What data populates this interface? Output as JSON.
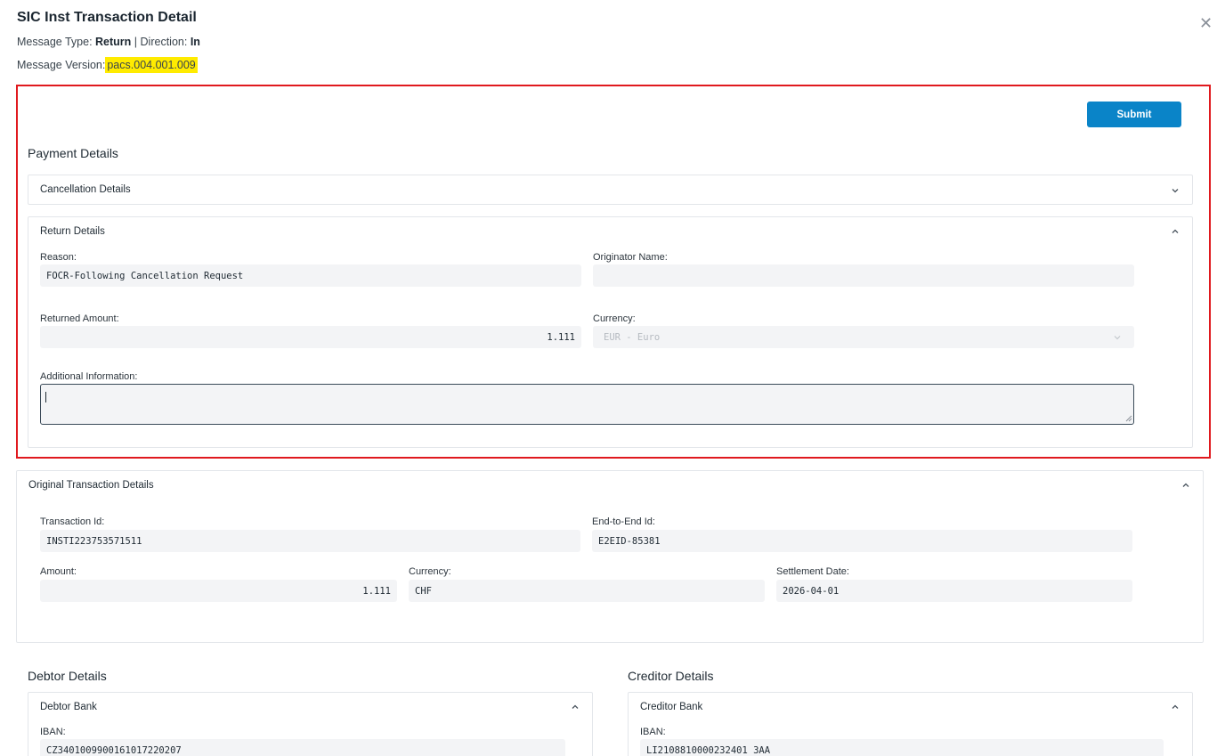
{
  "header": {
    "title": "SIC Inst Transaction Detail",
    "message_type_label": "Message Type:",
    "message_type_value": "Return",
    "separator": "|",
    "direction_label": "Direction:",
    "direction_value": "In",
    "message_version_label": "Message Version:",
    "message_version_value": "pacs.004.001.009",
    "close_icon": "close-icon"
  },
  "toolbar": {
    "submit_label": "Submit"
  },
  "payment_details": {
    "title": "Payment Details",
    "cancellation_panel": {
      "label": "Cancellation Details",
      "state": "collapsed"
    },
    "return_panel": {
      "label": "Return Details",
      "state": "expanded",
      "reason_label": "Reason:",
      "reason_value": "FOCR-Following Cancellation Request",
      "originator_name_label": "Originator Name:",
      "originator_name_value": "",
      "returned_amount_label": "Returned Amount:",
      "returned_amount_value": "1.111",
      "currency_label": "Currency:",
      "currency_value": "EUR - Euro",
      "additional_info_label": "Additional Information:",
      "additional_info_value": ""
    }
  },
  "original_transaction": {
    "label": "Original Transaction Details",
    "state": "expanded",
    "transaction_id_label": "Transaction Id:",
    "transaction_id_value": "INSTI223753571511",
    "end_to_end_id_label": "End-to-End Id:",
    "end_to_end_id_value": "E2EID-85381",
    "amount_label": "Amount:",
    "amount_value": "1.111",
    "currency_label": "Currency:",
    "currency_value": "CHF",
    "settlement_date_label": "Settlement Date:",
    "settlement_date_value": "2026-04-01"
  },
  "debtor": {
    "title": "Debtor Details",
    "bank_panel_label": "Debtor Bank",
    "iban_label": "IBAN:",
    "iban_value": "CZ3401009900161017220207"
  },
  "creditor": {
    "title": "Creditor Details",
    "bank_panel_label": "Creditor Bank",
    "iban_label": "IBAN:",
    "iban_value": "LI2108810000232401 3AA"
  },
  "colors": {
    "accent": "#0a84c8",
    "highlight": "#ffeb00",
    "annotation_border": "#e0191e",
    "field_bg": "#f3f4f6"
  }
}
